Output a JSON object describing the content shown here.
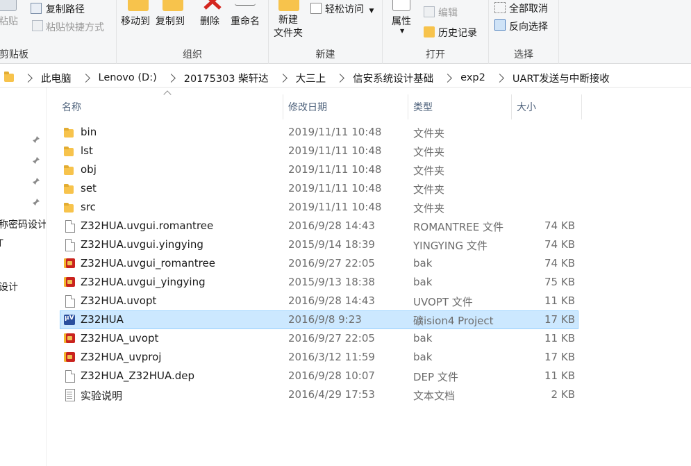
{
  "ribbon": {
    "clipboard": {
      "paste": "粘贴",
      "copy_path": "复制路径",
      "paste_shortcut": "粘贴快捷方式",
      "label": "剪贴板"
    },
    "organize": {
      "move_to": "移动到",
      "copy_to": "复制到",
      "delete": "删除",
      "rename": "重命名",
      "label": "组织"
    },
    "new": {
      "new_folder_line1": "新建",
      "new_folder_line2": "文件夹",
      "easy_access": "轻松访问",
      "label": "新建"
    },
    "open": {
      "properties": "属性",
      "edit": "编辑",
      "history": "历史记录",
      "label": "打开"
    },
    "select": {
      "select_none": "全部取消",
      "invert": "反向选择",
      "label": "选择"
    }
  },
  "address": {
    "crumbs": [
      "此电脑",
      "Lenovo (D:)",
      "20175303 柴轩达",
      "大三上",
      "信安系统设计基础",
      "exp2",
      "UART发送与中断接收"
    ]
  },
  "nav": {
    "items": [
      "称密码设计",
      "T",
      "设计"
    ]
  },
  "columns": {
    "name": "名称",
    "date": "修改日期",
    "type": "类型",
    "size": "大小"
  },
  "files": [
    {
      "name": "bin",
      "date": "2019/11/11 10:48",
      "type": "文件夹",
      "size": "",
      "icon": "folder-icon"
    },
    {
      "name": "lst",
      "date": "2019/11/11 10:48",
      "type": "文件夹",
      "size": "",
      "icon": "folder-icon"
    },
    {
      "name": "obj",
      "date": "2019/11/11 10:48",
      "type": "文件夹",
      "size": "",
      "icon": "folder-icon"
    },
    {
      "name": "set",
      "date": "2019/11/11 10:48",
      "type": "文件夹",
      "size": "",
      "icon": "folder-icon"
    },
    {
      "name": "src",
      "date": "2019/11/11 10:48",
      "type": "文件夹",
      "size": "",
      "icon": "folder-icon"
    },
    {
      "name": "Z32HUA.uvgui.romantree",
      "date": "2016/9/28 14:43",
      "type": "ROMANTREE 文件",
      "size": "74 KB",
      "icon": "file-icon"
    },
    {
      "name": "Z32HUA.uvgui.yingying",
      "date": "2015/9/14 18:39",
      "type": "YINGYING 文件",
      "size": "74 KB",
      "icon": "file-icon"
    },
    {
      "name": "Z32HUA.uvgui_romantree",
      "date": "2016/9/27 22:05",
      "type": "bak",
      "size": "74 KB",
      "icon": "bak-icon"
    },
    {
      "name": "Z32HUA.uvgui_yingying",
      "date": "2015/9/13 18:38",
      "type": "bak",
      "size": "75 KB",
      "icon": "bak-icon"
    },
    {
      "name": "Z32HUA.uvopt",
      "date": "2016/9/28 14:43",
      "type": "UVOPT 文件",
      "size": "11 KB",
      "icon": "file-icon"
    },
    {
      "name": "Z32HUA",
      "date": "2016/9/8 9:23",
      "type": "礦ision4 Project",
      "size": "17 KB",
      "icon": "uvision-project-icon",
      "selected": true
    },
    {
      "name": "Z32HUA_uvopt",
      "date": "2016/9/27 22:05",
      "type": "bak",
      "size": "11 KB",
      "icon": "bak-icon"
    },
    {
      "name": "Z32HUA_uvproj",
      "date": "2016/3/12 11:59",
      "type": "bak",
      "size": "17 KB",
      "icon": "bak-icon"
    },
    {
      "name": "Z32HUA_Z32HUA.dep",
      "date": "2016/9/28 10:07",
      "type": "DEP 文件",
      "size": "11 KB",
      "icon": "file-icon"
    },
    {
      "name": "实验说明",
      "date": "2016/4/29 17:53",
      "type": "文本文档",
      "size": "2 KB",
      "icon": "text-document-icon"
    }
  ]
}
